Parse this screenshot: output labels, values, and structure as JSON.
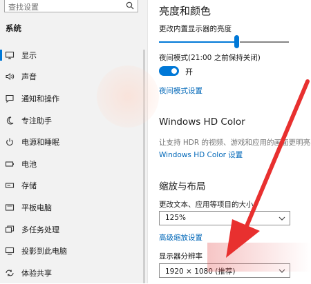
{
  "sidebar": {
    "search_placeholder": "查找设置",
    "section_title": "系统",
    "items": [
      {
        "label": "显示",
        "icon": "monitor-icon"
      },
      {
        "label": "声音",
        "icon": "speaker-icon"
      },
      {
        "label": "通知和操作",
        "icon": "notification-icon"
      },
      {
        "label": "专注助手",
        "icon": "moon-icon"
      },
      {
        "label": "电源和睡眠",
        "icon": "power-icon"
      },
      {
        "label": "电池",
        "icon": "battery-icon"
      },
      {
        "label": "存储",
        "icon": "storage-icon"
      },
      {
        "label": "平板电脑",
        "icon": "tablet-icon"
      },
      {
        "label": "多任务处理",
        "icon": "multitask-icon"
      },
      {
        "label": "投影到此电脑",
        "icon": "projector-icon"
      },
      {
        "label": "体验共享",
        "icon": "share-icon"
      }
    ]
  },
  "main": {
    "heading": "亮度和颜色",
    "brightness_label": "更改内置显示器的亮度",
    "brightness_value": 0.6,
    "night_mode_label": "夜间模式(21:00 之前保持关闭)",
    "night_mode_state": "开",
    "night_mode_link": "夜间模式设置",
    "hdr_heading": "Windows HD Color",
    "hdr_desc": "让支持 HDR 的视频、游戏和应用的画面更明亮、",
    "hdr_link": "Windows HD Color 设置",
    "scale_heading": "缩放与布局",
    "scale_label": "更改文本、应用等项目的大小",
    "scale_value": "125%",
    "advanced_link": "高级缩放设置",
    "resolution_label": "显示器分辨率",
    "resolution_value": "1920 × 1080 (推荐)"
  },
  "colors": {
    "accent": "#0078d7",
    "link": "#0067b8",
    "arrow": "#e8302f"
  }
}
